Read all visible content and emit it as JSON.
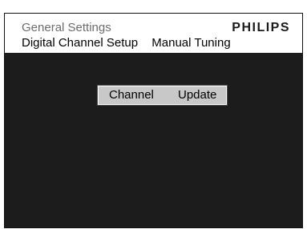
{
  "header": {
    "title": "General Settings",
    "brand": "PHILIPS",
    "breadcrumb": [
      "Digital Channel Setup",
      "Manual Tuning"
    ]
  },
  "popup": {
    "label": [
      "Channel",
      "Update"
    ]
  },
  "colors": {
    "screen_background": "#1c1c1c",
    "header_background": "#ffffff",
    "popup_background": "#c8c8c8"
  }
}
